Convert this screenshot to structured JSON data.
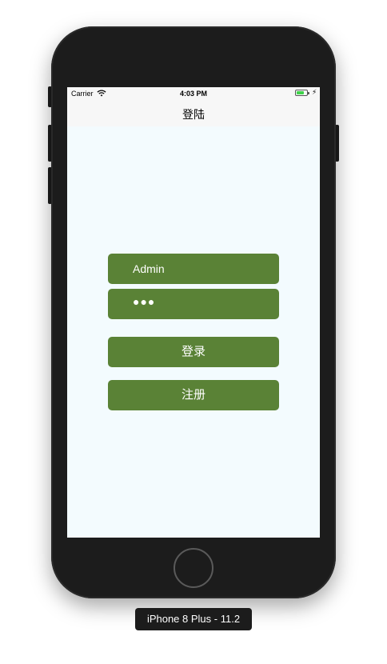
{
  "status_bar": {
    "carrier": "Carrier",
    "time": "4:03 PM",
    "wifi_icon": "wifi-icon",
    "battery_icon": "battery-icon",
    "charging_icon": "bolt-icon"
  },
  "nav": {
    "title": "登陆"
  },
  "form": {
    "username_value": "Admin",
    "password_masked": "●●●",
    "login_label": "登录",
    "register_label": "注册",
    "accent_color": "#5a8236",
    "background_color": "#f3fbfe"
  },
  "device": {
    "label": "iPhone 8 Plus - 11.2"
  }
}
